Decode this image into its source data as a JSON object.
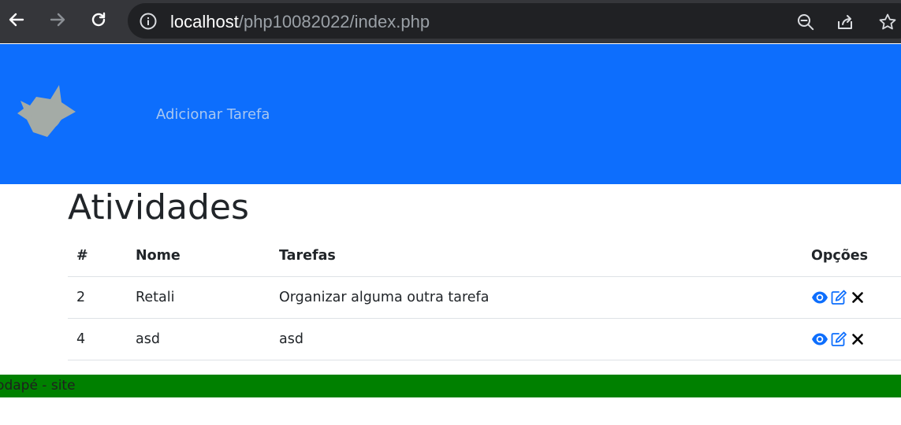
{
  "browser": {
    "url_host": "localhost",
    "url_path": "/php10082022/index.php"
  },
  "header": {
    "nav_link": "Adicionar Tarefa"
  },
  "main": {
    "title": "Atividades",
    "columns": [
      "#",
      "Nome",
      "Tarefas",
      "Opções"
    ],
    "rows": [
      {
        "id": "2",
        "nome": "Retali",
        "tarefa": "Organizar alguma outra tarefa"
      },
      {
        "id": "4",
        "nome": "asd",
        "tarefa": "asd"
      }
    ],
    "option_icons": [
      "eye-icon",
      "edit-icon",
      "close-icon"
    ]
  },
  "footer": {
    "text": "Rodapé - site"
  },
  "colors": {
    "header_bg": "#0d6efd",
    "footer_bg": "#008000",
    "icon_blue": "#0d6efd"
  }
}
